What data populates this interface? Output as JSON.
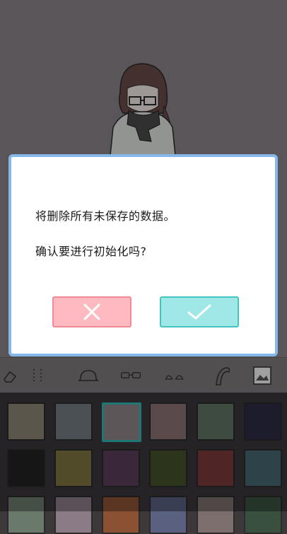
{
  "dialog": {
    "message_line1": "将删除所有未保存的数据。",
    "message_line2": "确认要进行初始化吗?",
    "cancel_icon": "close-icon",
    "confirm_icon": "check-icon"
  },
  "toolbar": {
    "icons": [
      "eraser-icon",
      "accessory-icon",
      "hat-icon",
      "glasses-icon",
      "ears-icon",
      "hair-strand-icon",
      "background-image-icon"
    ]
  },
  "palette": {
    "rows": [
      [
        "#8a8474",
        "#707a80",
        "#8f8588",
        "#8b7174",
        "#5f7463",
        "#2b2c44"
      ],
      [
        "#232323",
        "#7d7440",
        "#5a3d5a",
        "#44512c",
        "#7a3a3b",
        "#476670"
      ],
      [
        "#6a7a6a",
        "#8a7b86",
        "#8a5233",
        "#5a6080",
        "#7b6e6d",
        "#39503e"
      ]
    ],
    "selected_index": 2,
    "colors": {
      "accent": "#2fb7b2",
      "dialog_border": "#86b7ea",
      "cancel": "#ffb9c0",
      "confirm": "#9fe8e7"
    }
  }
}
